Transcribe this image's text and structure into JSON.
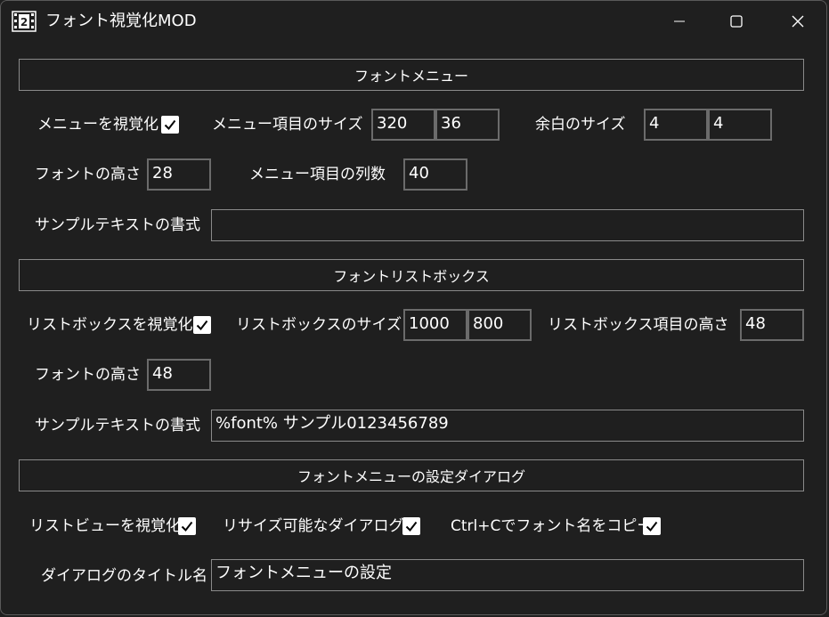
{
  "window": {
    "title": "フォント視覚化MOD",
    "icon": "film-number-icon",
    "icon_text": "2",
    "controls": [
      "minimize-icon",
      "maximize-icon",
      "close-icon"
    ]
  },
  "menu_section": {
    "header": "フォントメニュー",
    "visualize_label": "メニューを視覚化",
    "visualize_checked": true,
    "item_size_label": "メニュー項目のサイズ",
    "item_size_w": "320",
    "item_size_h": "36",
    "margin_label": "余白のサイズ",
    "margin_x": "4",
    "margin_y": "4",
    "font_height_label": "フォントの高さ",
    "font_height": "28",
    "columns_label": "メニュー項目の列数",
    "columns": "40",
    "sample_format_label": "サンプルテキストの書式",
    "sample_format": ""
  },
  "listbox_section": {
    "header": "フォントリストボックス",
    "visualize_label": "リストボックスを視覚化",
    "visualize_checked": true,
    "size_label": "リストボックスのサイズ",
    "size_w": "1000",
    "size_h": "800",
    "item_height_label": "リストボックス項目の高さ",
    "item_height": "48",
    "font_height_label": "フォントの高さ",
    "font_height": "48",
    "sample_format_label": "サンプルテキストの書式",
    "sample_format": "%font% サンプル0123456789"
  },
  "dialog_section": {
    "header": "フォントメニューの設定ダイアログ",
    "listview_label": "リストビューを視覚化",
    "listview_checked": true,
    "resizable_label": "リサイズ可能なダイアログ",
    "resizable_checked": true,
    "copy_label": "Ctrl+Cでフォント名をコピー",
    "copy_checked": true,
    "dialog_title_label": "ダイアログのタイトル名",
    "dialog_title": "フォントメニューの設定"
  },
  "colors": {
    "background": "#1f1f1f",
    "text": "#ffffff",
    "border": "#8a8a8a"
  }
}
